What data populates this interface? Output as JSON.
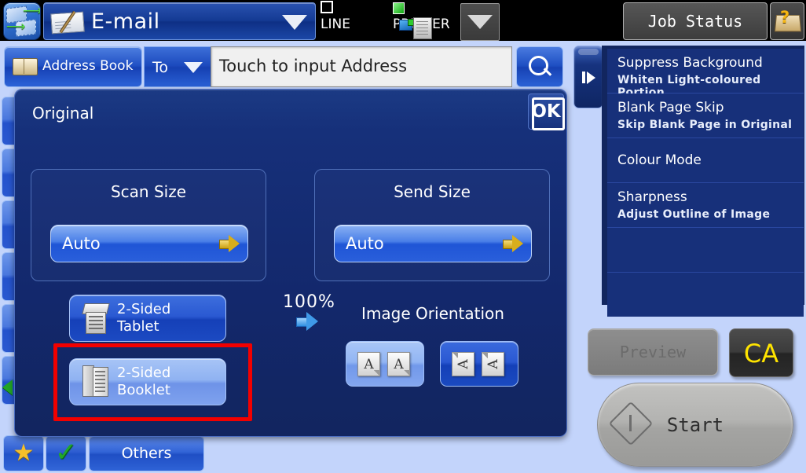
{
  "topbar": {
    "app_icon": "scan-send-icon",
    "mode_label": "E-mail",
    "mode_caret": "chevron-down-icon",
    "line_label": "LINE",
    "printer_label": "PRINTER",
    "dropdown_caret": "chevron-down-icon",
    "job_status_label": "Job Status",
    "help_icon": "help-book-icon"
  },
  "address_row": {
    "address_book_label": "Address Book",
    "recipient_type": "To",
    "recipient_caret": "chevron-down-icon",
    "address_placeholder": "Touch to input Address",
    "address_value": "",
    "search_icon": "search-icon"
  },
  "tab_handle": {
    "icon": "expand-panel-icon"
  },
  "right_panel": {
    "rows": [
      {
        "title": "Suppress Background",
        "subtitle": "Whiten Light-coloured Portion"
      },
      {
        "title": "Blank Page Skip",
        "subtitle": "Skip Blank Page in Original"
      },
      {
        "title": "Colour Mode",
        "subtitle": ""
      },
      {
        "title": "Sharpness",
        "subtitle": "Adjust Outline of Image"
      },
      {
        "title": "",
        "subtitle": ""
      },
      {
        "title": "",
        "subtitle": ""
      }
    ]
  },
  "dialog": {
    "title": "Original",
    "ok_label": "OK",
    "scan_size": {
      "header": "Scan Size",
      "value": "Auto",
      "arrow_icon": "yellow-right-arrow-icon"
    },
    "send_size": {
      "header": "Send Size",
      "value": "Auto",
      "arrow_icon": "yellow-right-arrow-icon"
    },
    "ratio": {
      "value": "100%",
      "arrow_icon": "blue-right-arrow-icon"
    },
    "duplex": [
      {
        "line1": "2-Sided",
        "line2": "Tablet",
        "icon": "two-sided-tablet-icon",
        "selected": false,
        "highlighted": false
      },
      {
        "line1": "2-Sided",
        "line2": "Booklet",
        "icon": "two-sided-booklet-icon",
        "selected": true,
        "highlighted": true
      }
    ],
    "image_orientation": {
      "title": "Image Orientation",
      "options": [
        {
          "icon": "portrait-orientation-icon",
          "glyph1": "A",
          "glyph2": "A",
          "selected": true
        },
        {
          "icon": "landscape-orientation-icon",
          "glyph1": "A",
          "glyph2": "A",
          "selected": false
        }
      ]
    },
    "highlight_color": "#f20000"
  },
  "bottom_bar": {
    "favourite_icon": "star-icon",
    "check_icon": "check-icon",
    "others_label": "Others"
  },
  "controls": {
    "preview_label": "Preview",
    "preview_enabled": false,
    "ca_label": "CA",
    "ca_color": "#ffe400",
    "start_label": "Start",
    "start_icon": "start-diamond-icon"
  }
}
